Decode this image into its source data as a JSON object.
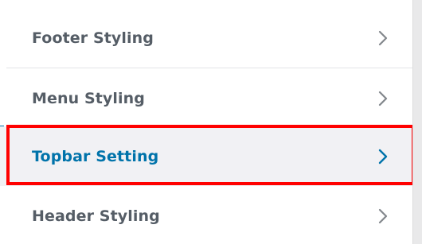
{
  "menu": {
    "items": [
      {
        "label": "Footer Styling",
        "chevron": "chevron-right-icon"
      },
      {
        "label": "Menu Styling",
        "chevron": "chevron-right-icon"
      },
      {
        "label": "Topbar Setting",
        "chevron": "chevron-right-icon",
        "active": true
      },
      {
        "label": "Header Styling",
        "chevron": "chevron-right-icon"
      }
    ]
  },
  "colors": {
    "label": "#555d66",
    "active_label": "#0073aa",
    "active_background": "#f1f1f4",
    "divider": "#e2e4e7",
    "highlight": "#ff0000",
    "chevron": "#82878c",
    "active_chevron": "#0073aa"
  }
}
